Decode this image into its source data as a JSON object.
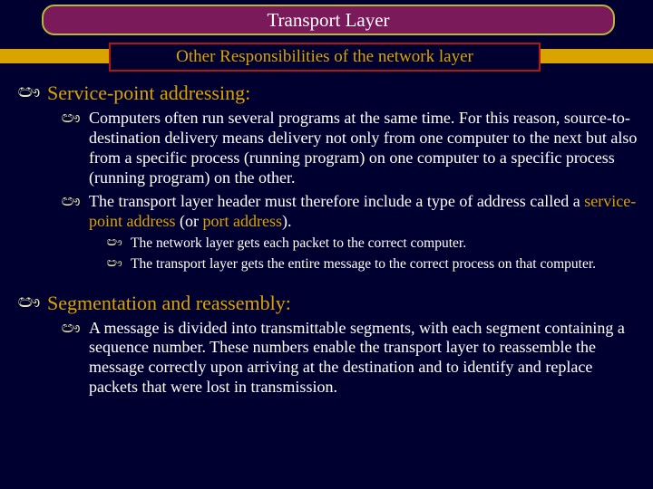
{
  "glyph": "ඐ",
  "title": "Transport Layer",
  "subtitle": "Other Responsibilities of the network layer",
  "section1": {
    "heading": "Service-point addressing:",
    "p1": "Computers often run several programs at the same time. For this reason, source-to-destination delivery means delivery not only from one computer to the next but also from a specific process (running program) on one computer to a specific process (running program) on the other.",
    "p2_a": "The transport layer header must therefore include a type of address called a ",
    "p2_hl1": "service-point address",
    "p2_b": " (or ",
    "p2_hl2": "port address",
    "p2_c": ").",
    "sub1": "The network layer gets each packet to the correct computer.",
    "sub2": "The transport layer gets the entire message to the correct process on that computer."
  },
  "section2": {
    "heading": "Segmentation and reassembly:",
    "p1": "A message is divided into transmittable segments, with each segment containing a sequence number. These numbers enable the transport layer to reassemble the message correctly upon arriving at the destination and to identify and replace packets that were lost in transmission."
  }
}
